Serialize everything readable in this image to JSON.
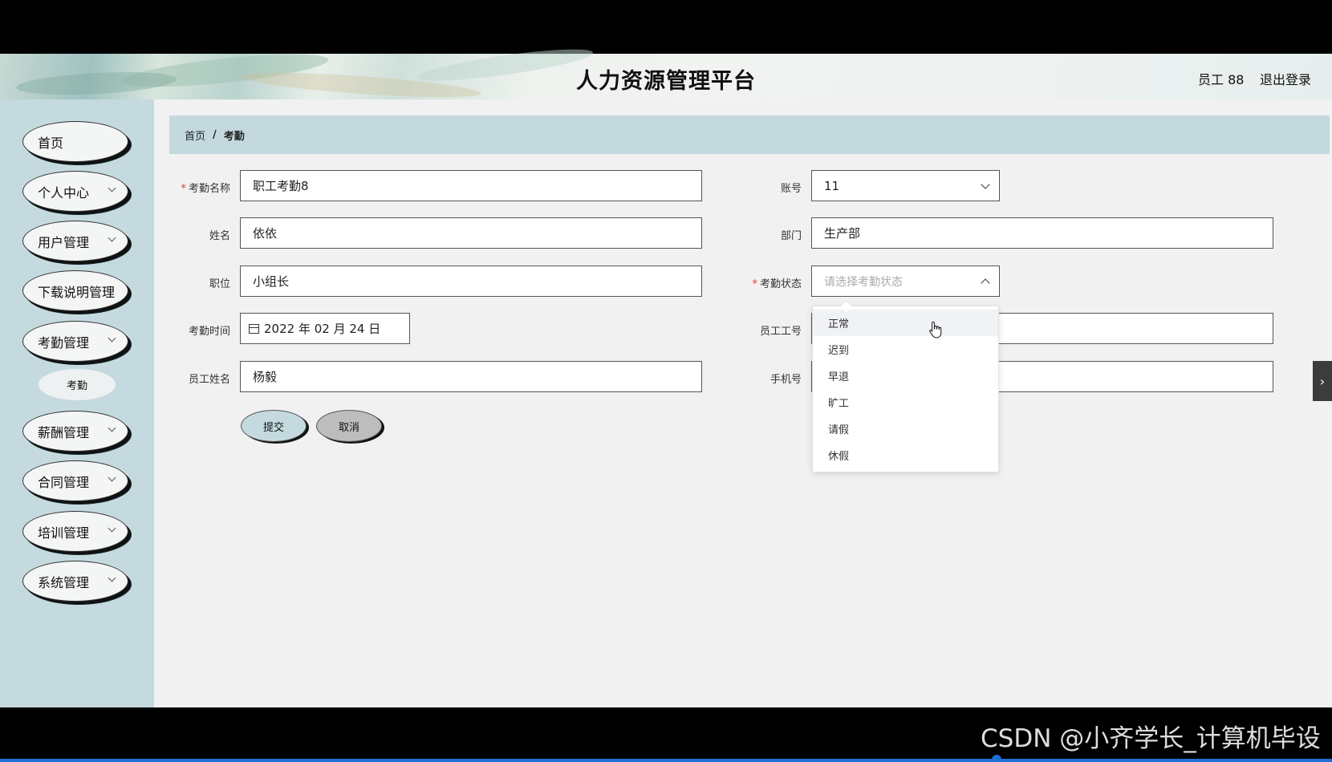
{
  "header": {
    "title": "人力资源管理平台",
    "user_label": "员工 88",
    "logout_label": "退出登录"
  },
  "sidebar": {
    "items": [
      {
        "label": "首页",
        "has_chevron": false
      },
      {
        "label": "个人中心",
        "has_chevron": true
      },
      {
        "label": "用户管理",
        "has_chevron": true
      },
      {
        "label": "下载说明管理",
        "has_chevron": false
      },
      {
        "label": "考勤管理",
        "has_chevron": true
      },
      {
        "label": "薪酬管理",
        "has_chevron": true
      },
      {
        "label": "合同管理",
        "has_chevron": true
      },
      {
        "label": "培训管理",
        "has_chevron": true
      },
      {
        "label": "系统管理",
        "has_chevron": true
      }
    ],
    "subitem": "考勤"
  },
  "breadcrumb": {
    "home": "首页",
    "separator": "/",
    "current": "考勤"
  },
  "form": {
    "attendance_name": {
      "label": "考勤名称",
      "value": "职工考勤8",
      "required": true
    },
    "name": {
      "label": "姓名",
      "value": "依依"
    },
    "position": {
      "label": "职位",
      "value": "小组长"
    },
    "attendance_time": {
      "label": "考勤时间",
      "value": "2022 年 02 月 24 日"
    },
    "employee_name": {
      "label": "员工姓名",
      "value": "杨毅"
    },
    "account": {
      "label": "账号",
      "value": "11"
    },
    "department": {
      "label": "部门",
      "value": "生产部"
    },
    "attendance_status": {
      "label": "考勤状态",
      "placeholder": "请选择考勤状态",
      "required": true
    },
    "employee_id": {
      "label": "员工工号",
      "value": ""
    },
    "phone": {
      "label": "手机号",
      "value": ""
    },
    "submit_label": "提交",
    "cancel_label": "取消",
    "required_mark": "*"
  },
  "dropdown": {
    "options": [
      "正常",
      "迟到",
      "早退",
      "旷工",
      "请假",
      "休假"
    ],
    "hovered_index": 0
  },
  "watermark": "CSDN @小齐学长_计算机毕设",
  "colors": {
    "sidebar_bg": "#c4dadf",
    "main_bg": "#f1f1f1",
    "required": "#e23b3b",
    "progress": "#1e6fd6"
  },
  "icons": {
    "calendar": "calendar-icon",
    "chevron": "chevron-down-icon",
    "expand": "chevron-right-icon"
  }
}
